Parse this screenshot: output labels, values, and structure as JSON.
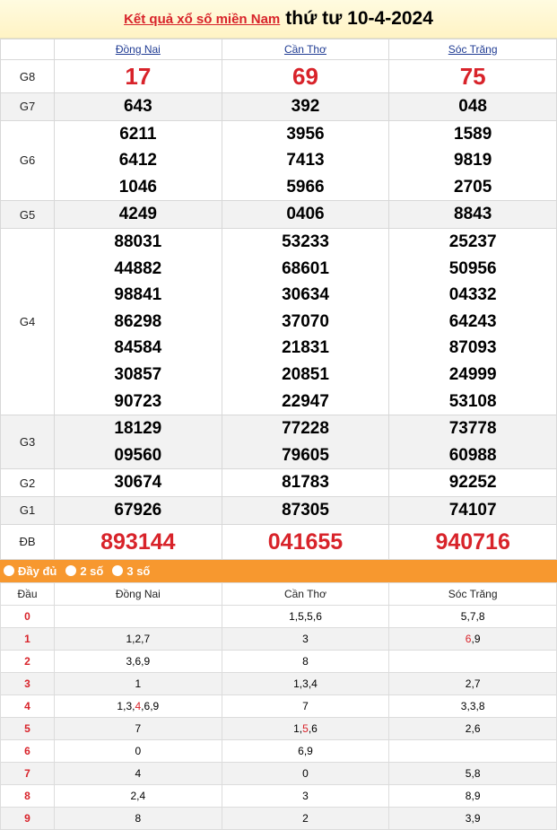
{
  "header": {
    "link": "Kết quả xổ số miền Nam",
    "date": "thứ tư 10-4-2024"
  },
  "provinces": [
    "Đồng Nai",
    "Cần Thơ",
    "Sóc Trăng"
  ],
  "prizes": [
    {
      "label": "G8",
      "values": [
        [
          "17"
        ],
        [
          "69"
        ],
        [
          "75"
        ]
      ]
    },
    {
      "label": "G7",
      "values": [
        [
          "643"
        ],
        [
          "392"
        ],
        [
          "048"
        ]
      ]
    },
    {
      "label": "G6",
      "values": [
        [
          "6211",
          "6412",
          "1046"
        ],
        [
          "3956",
          "7413",
          "5966"
        ],
        [
          "1589",
          "9819",
          "2705"
        ]
      ]
    },
    {
      "label": "G5",
      "values": [
        [
          "4249"
        ],
        [
          "0406"
        ],
        [
          "8843"
        ]
      ]
    },
    {
      "label": "G4",
      "values": [
        [
          "88031",
          "44882",
          "98841",
          "86298",
          "84584",
          "30857",
          "90723"
        ],
        [
          "53233",
          "68601",
          "30634",
          "37070",
          "21831",
          "20851",
          "22947"
        ],
        [
          "25237",
          "50956",
          "04332",
          "64243",
          "87093",
          "24999",
          "53108"
        ]
      ]
    },
    {
      "label": "G3",
      "values": [
        [
          "18129",
          "09560"
        ],
        [
          "77228",
          "79605"
        ],
        [
          "73778",
          "60988"
        ]
      ]
    },
    {
      "label": "G2",
      "values": [
        [
          "30674"
        ],
        [
          "81783"
        ],
        [
          "92252"
        ]
      ]
    },
    {
      "label": "G1",
      "values": [
        [
          "67926"
        ],
        [
          "87305"
        ],
        [
          "74107"
        ]
      ]
    },
    {
      "label": "ĐB",
      "values": [
        [
          "893144"
        ],
        [
          "041655"
        ],
        [
          "940716"
        ]
      ]
    }
  ],
  "filter": {
    "options": [
      "Đầy đủ",
      "2 số",
      "3 số"
    ]
  },
  "loto": {
    "head_label": "Đầu",
    "rows": [
      {
        "dau": "0",
        "cells": [
          [],
          [
            "1",
            "5",
            "5",
            "6"
          ],
          [
            "5",
            "7",
            "8"
          ]
        ]
      },
      {
        "dau": "1",
        "cells": [
          [
            "1",
            "2",
            "7"
          ],
          [
            "3"
          ],
          [
            "6",
            "9"
          ]
        ]
      },
      {
        "dau": "2",
        "cells": [
          [
            "3",
            "6",
            "9"
          ],
          [
            "8"
          ],
          []
        ]
      },
      {
        "dau": "3",
        "cells": [
          [
            "1"
          ],
          [
            "1",
            "3",
            "4"
          ],
          [
            "2",
            "7"
          ]
        ]
      },
      {
        "dau": "4",
        "cells": [
          [
            "1",
            "3",
            "4",
            "6",
            "9"
          ],
          [
            "7"
          ],
          [
            "3",
            "3",
            "8"
          ]
        ]
      },
      {
        "dau": "5",
        "cells": [
          [
            "7"
          ],
          [
            "1",
            "5",
            "6"
          ],
          [
            "2",
            "6"
          ]
        ]
      },
      {
        "dau": "6",
        "cells": [
          [
            "0"
          ],
          [
            "6",
            "9"
          ],
          []
        ]
      },
      {
        "dau": "7",
        "cells": [
          [
            "4"
          ],
          [
            "0"
          ],
          [
            "5",
            "8"
          ]
        ]
      },
      {
        "dau": "8",
        "cells": [
          [
            "2",
            "4"
          ],
          [
            "3"
          ],
          [
            "8",
            "9"
          ]
        ]
      },
      {
        "dau": "9",
        "cells": [
          [
            "8"
          ],
          [
            "2"
          ],
          [
            "3",
            "9"
          ]
        ]
      }
    ],
    "highlights": [
      [
        1,
        2,
        0
      ],
      [
        4,
        0,
        2
      ],
      [
        5,
        1,
        1
      ]
    ]
  },
  "colors": {
    "accent_red": "#d8232a",
    "filter_orange": "#f7982f",
    "province_blue": "#1f3b93"
  }
}
